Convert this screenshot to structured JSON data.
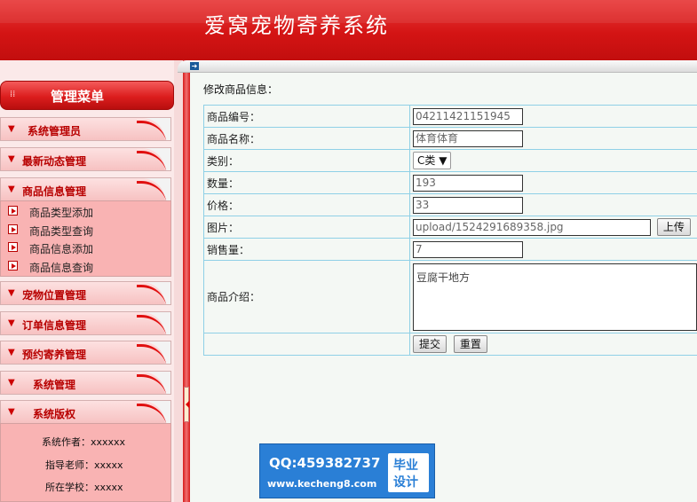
{
  "header": {
    "title": "爱窝宠物寄养系统"
  },
  "sidebar": {
    "menu_title": "管理菜单",
    "sections": [
      {
        "label": "系统管理员"
      },
      {
        "label": "最新动态管理"
      },
      {
        "label": "商品信息管理",
        "items": [
          "商品类型添加",
          "商品类型查询",
          "商品信息添加",
          "商品信息查询"
        ]
      },
      {
        "label": "宠物位置管理"
      },
      {
        "label": "订单信息管理"
      },
      {
        "label": "预约寄养管理"
      },
      {
        "label": "系统管理"
      },
      {
        "label": "系统版权"
      }
    ],
    "copyright_info": [
      {
        "label": "系统作者：",
        "value": "xxxxxx"
      },
      {
        "label": "指导老师：",
        "value": "xxxxx"
      },
      {
        "label": "所在学校：",
        "value": "xxxxx"
      }
    ]
  },
  "content": {
    "page_title": "修改商品信息：",
    "form": {
      "code": {
        "label": "商品编号：",
        "value": "04211421151945"
      },
      "name": {
        "label": "商品名称：",
        "value": "体育体育"
      },
      "category": {
        "label": "类别：",
        "value": "C类"
      },
      "quantity": {
        "label": "数量：",
        "value": "193"
      },
      "price": {
        "label": "价格：",
        "value": "33"
      },
      "image": {
        "label": "图片：",
        "value": "upload/1524291689358.jpg",
        "upload_label": "上传"
      },
      "sales": {
        "label": "销售量：",
        "value": "7"
      },
      "intro": {
        "label": "商品介绍：",
        "value": "豆腐干地方"
      },
      "submit_label": "提交",
      "reset_label": "重置"
    }
  },
  "watermark": {
    "qq": "QQ:459382737",
    "url": "www.kecheng8.com",
    "badge_line1": "毕业",
    "badge_line2": "设计"
  },
  "colors": {
    "header_red": "#d41414",
    "sidebar_pink": "#f9b3b3",
    "table_border": "#8fd0e6",
    "watermark_blue": "#2a7fd6"
  }
}
